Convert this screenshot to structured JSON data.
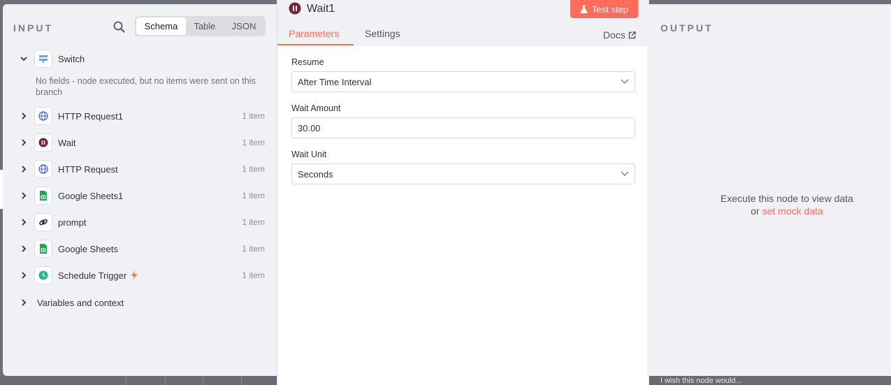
{
  "input": {
    "title": "INPUT",
    "view_tabs": [
      "Schema",
      "Table",
      "JSON"
    ],
    "active_view": "Schema",
    "switch_node": {
      "label": "Switch",
      "message": "No fields - node executed, but no items were sent on this branch"
    },
    "nodes": [
      {
        "label": "HTTP Request1",
        "count": "1 item",
        "icon": "globe-icon"
      },
      {
        "label": "Wait",
        "count": "1 item",
        "icon": "pause-icon"
      },
      {
        "label": "HTTP Request",
        "count": "1 item",
        "icon": "globe-icon"
      },
      {
        "label": "Google Sheets1",
        "count": "1 item",
        "icon": "sheets-icon"
      },
      {
        "label": "prompt",
        "count": "1 item",
        "icon": "link-icon"
      },
      {
        "label": "Google Sheets",
        "count": "1 item",
        "icon": "sheets-icon"
      },
      {
        "label": "Schedule Trigger",
        "count": "1 item",
        "icon": "clock-icon"
      }
    ],
    "variables_label": "Variables and context"
  },
  "node_panel": {
    "title": "Wait1",
    "test_button": "Test step",
    "tabs": [
      "Parameters",
      "Settings"
    ],
    "active_tab": "Parameters",
    "docs_label": "Docs",
    "fields": {
      "resume_label": "Resume",
      "resume_value": "After Time Interval",
      "amount_label": "Wait Amount",
      "amount_value": "30.00",
      "unit_label": "Wait Unit",
      "unit_value": "Seconds"
    }
  },
  "output": {
    "title": "OUTPUT",
    "message_line1": "Execute this node to view data",
    "message_or": "or",
    "mock_link": "set mock data"
  },
  "background_text": "I wish this node would...",
  "colors": {
    "accent": "#ff6d5a",
    "panel_bg": "#f0f1f5",
    "wait_icon": "#7a1f3a",
    "globe": "#3b5bd9",
    "sheets": "#23a35a",
    "clock": "#2bb58a",
    "trigger_bolt": "#ff6d5a"
  }
}
